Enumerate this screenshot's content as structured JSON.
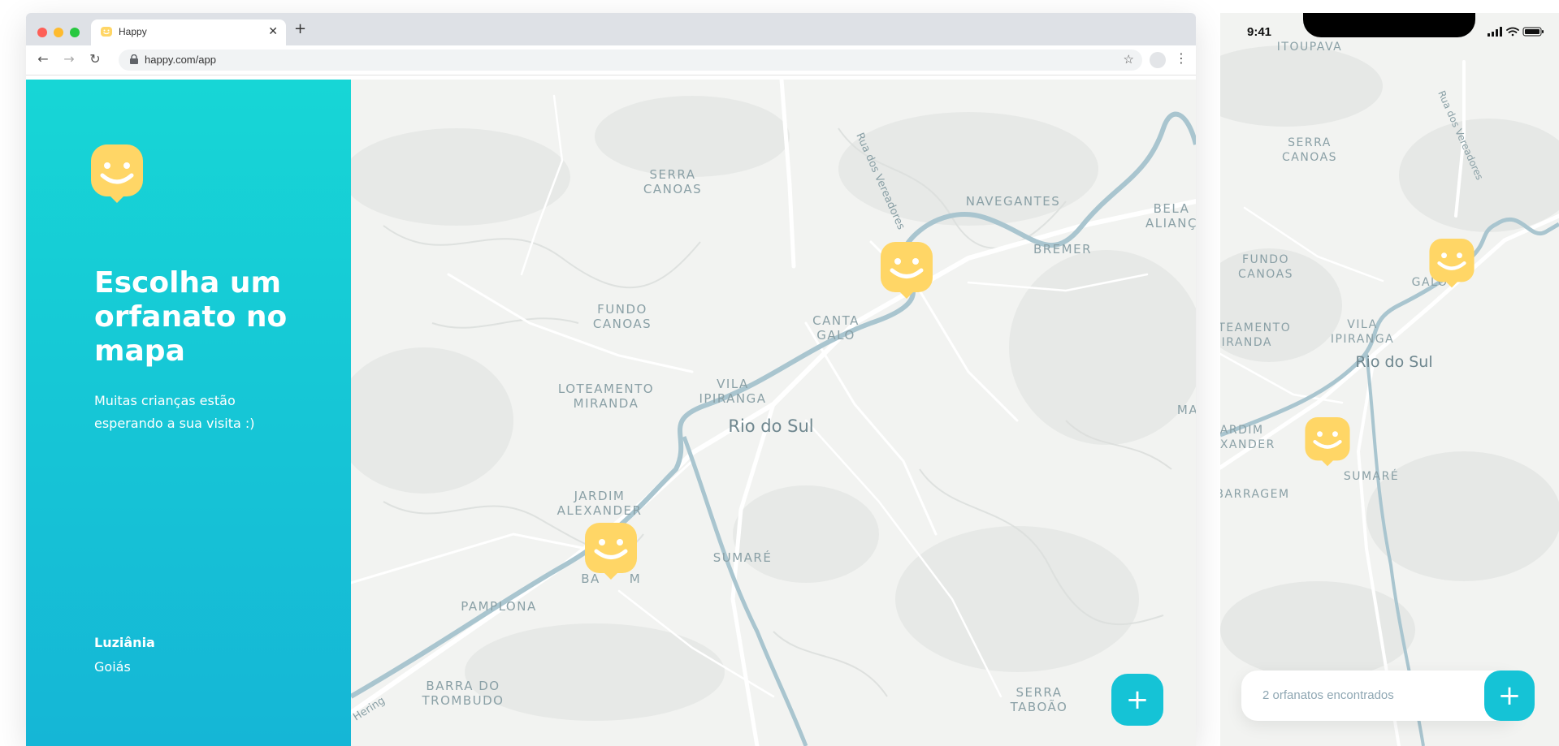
{
  "browser": {
    "tab_title": "Happy",
    "url": "happy.com/app"
  },
  "sidebar": {
    "title": "Escolha um orfanato no mapa",
    "subtitle": "Muitas crianças estão esperando a sua visita :)",
    "city": "Luziânia",
    "state": "Goiás"
  },
  "map": {
    "labels": {
      "serra_canoas": [
        "SERRA",
        "CANOAS"
      ],
      "rua_vereadores": "Rua dos Vereadores",
      "navegantes": "NAVEGANTES",
      "bela_alianca": [
        "BELA",
        "ALIANÇ"
      ],
      "bremer": "BREMER",
      "fundo_canoas": [
        "FUNDO",
        "CANOAS"
      ],
      "canta_galo": [
        "CANTA",
        "GALO"
      ],
      "vila_ipiranga": [
        "VILA",
        "IPIRANGA"
      ],
      "loteamento_miranda": [
        "LOTEAMENTO",
        "MIRANDA"
      ],
      "rio_do_sul": "Rio do Sul",
      "ma": "MA",
      "jardim_alexander": [
        "JARDIM",
        "ALEXANDER"
      ],
      "sumare": "SUMARÉ",
      "barragem_fragment": [
        "BA",
        "M"
      ],
      "pamplona": "PAMPLONA",
      "hering": "Hering",
      "barra_trombudo": [
        "BARRA DO",
        "TROMBUDO"
      ],
      "serra_taboao": [
        "SERRA",
        "TABOÃO"
      ]
    },
    "add_button_icon": "plus-icon"
  },
  "phone": {
    "time": "9:41",
    "labels": {
      "itoupava": "ITOUPAVA",
      "rua_vereadores": "Rua dos Vereadores",
      "serra_canoas": [
        "SERRA",
        "CANOAS"
      ],
      "fundo_canoas": [
        "FUNDO",
        "CANOAS"
      ],
      "galo": "GALO",
      "loteamento_miranda": [
        "OTEAMENTO",
        "MIRANDA"
      ],
      "vila_ipiranga": [
        "VILA",
        "IPIRANGA"
      ],
      "rio_do_sul": "Rio do Sul",
      "jardim_alexander": [
        "JARDIM",
        "LEXANDER"
      ],
      "sumare": "SUMARÉ",
      "barragem": "BARRAGEM"
    },
    "footer_text": "2 orfanatos encontrados"
  },
  "colors": {
    "brand_gradient_top": "#17d6d6",
    "brand_gradient_bottom": "#15b6d6",
    "marker_yellow": "#ffd666",
    "button_cyan": "#15c3d6",
    "river": "#a9c5cf"
  }
}
